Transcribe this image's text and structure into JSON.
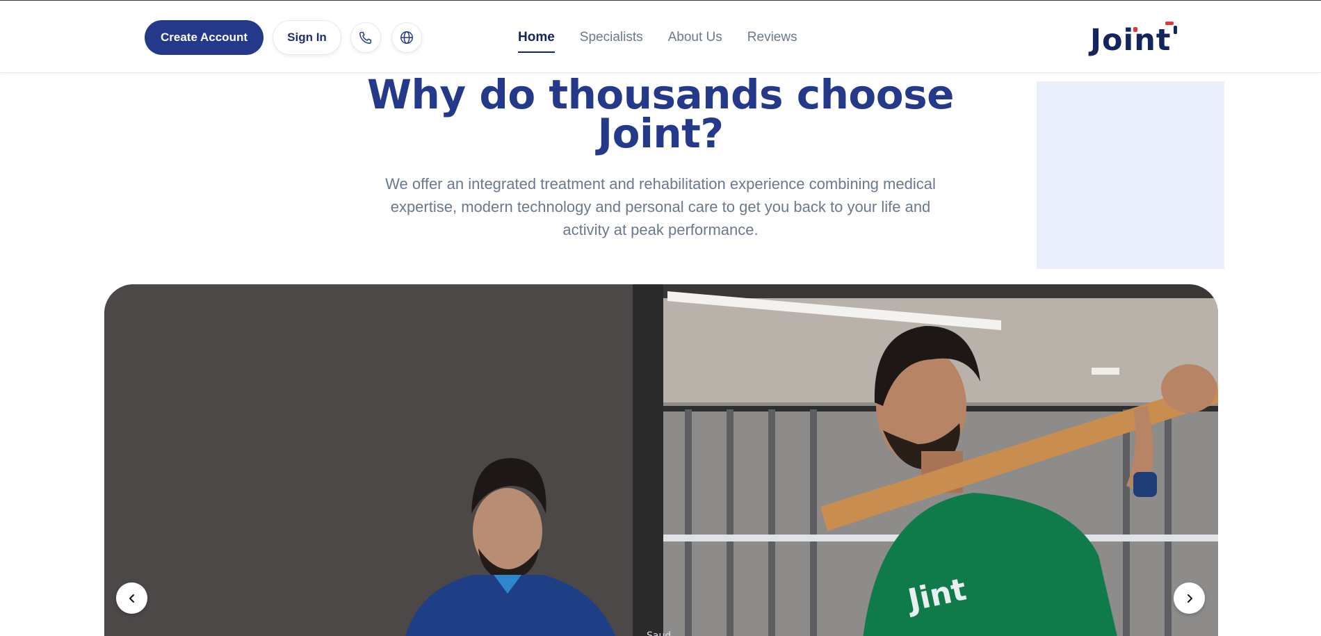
{
  "header": {
    "create_account_label": "Create Account",
    "sign_in_label": "Sign In",
    "phone_icon": "phone-icon",
    "language_icon": "globe-icon",
    "nav": [
      {
        "label": "Home",
        "active": true
      },
      {
        "label": "Specialists",
        "active": false
      },
      {
        "label": "About Us",
        "active": false
      },
      {
        "label": "Reviews",
        "active": false
      }
    ],
    "logo_text": "Joint"
  },
  "hero": {
    "title_line1": "Why do thousands choose",
    "title_line2": "Joint?",
    "description_line1": "We offer an integrated treatment and rehabilitation experience combining medical",
    "description_line2": "expertise, modern technology and personal care to get you back to your life and",
    "description_line3": "activity at peak performance."
  },
  "carousel": {
    "prev_icon": "chevron-left-icon",
    "next_icon": "chevron-right-icon"
  },
  "colors": {
    "brand_navy": "#24398a",
    "text_dark": "#13245e",
    "text_muted": "#6b7890",
    "accent_red": "#e8333a",
    "panel_bg": "#eaf0fb"
  }
}
